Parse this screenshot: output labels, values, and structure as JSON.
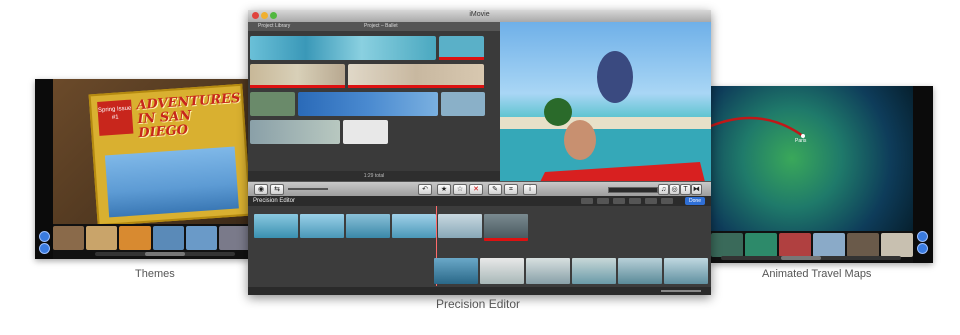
{
  "captions": {
    "themes": "Themes",
    "precision_editor": "Precision Editor",
    "travel_maps": "Animated Travel Maps"
  },
  "left_panel": {
    "poster_title": "ADVENTURES IN SAN DIEGO",
    "issue_badge": "Spring Issue #1"
  },
  "imovie_window": {
    "title": "iMovie",
    "library_header_left": "Project Library",
    "library_header_center": "Project – Ballet",
    "library_footer": "1:29 total",
    "precision_editor_label": "Precision Editor",
    "done_label": "Done"
  },
  "right_panel": {
    "map_label": "Paris"
  },
  "icons": [
    "star-icon",
    "unstar-icon",
    "reject-icon",
    "crop-icon",
    "info-icon",
    "play-icon",
    "fullscreen-icon",
    "camera-icon",
    "undo-icon"
  ]
}
